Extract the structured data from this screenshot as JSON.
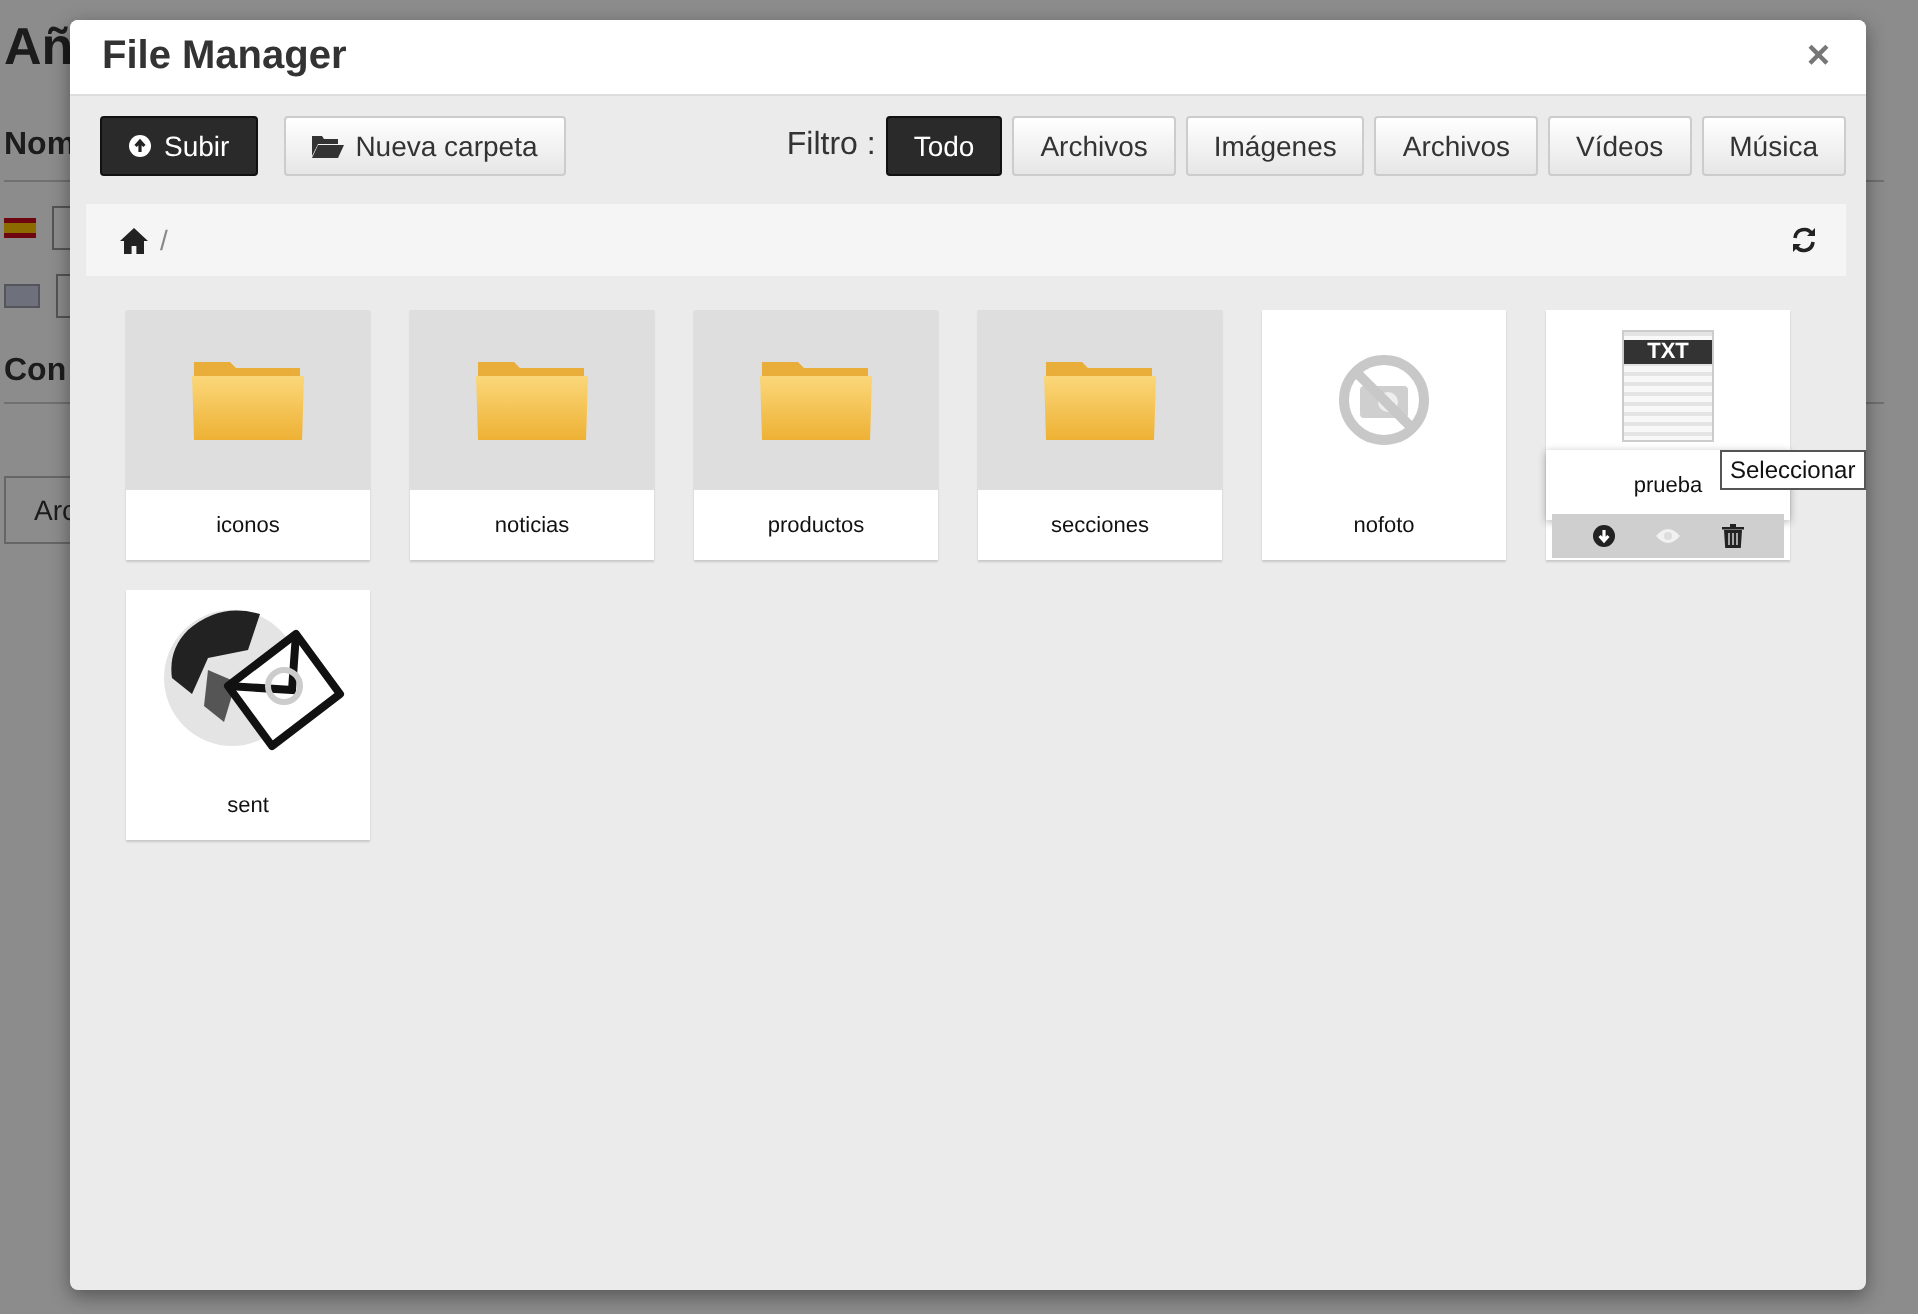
{
  "background_page": {
    "title": "Añ",
    "section_1": "Nom",
    "section_2": "Con",
    "tab": "Arc"
  },
  "modal": {
    "title": "File Manager",
    "close": "×"
  },
  "toolbar": {
    "upload": "Subir",
    "new_folder": "Nueva carpeta",
    "filter_label": "Filtro :",
    "filters": [
      {
        "label": "Todo",
        "selected": true
      },
      {
        "label": "Archivos",
        "selected": false
      },
      {
        "label": "Imágenes",
        "selected": false
      },
      {
        "label": "Archivos",
        "selected": false
      },
      {
        "label": "Vídeos",
        "selected": false
      },
      {
        "label": "Música",
        "selected": false
      }
    ]
  },
  "breadcrumb": {
    "separator": "/"
  },
  "items": [
    {
      "kind": "folder",
      "name": "iconos",
      "hovered": false
    },
    {
      "kind": "folder",
      "name": "noticias",
      "hovered": false
    },
    {
      "kind": "folder",
      "name": "productos",
      "hovered": false
    },
    {
      "kind": "folder",
      "name": "secciones",
      "hovered": false
    },
    {
      "kind": "nophoto",
      "name": "nofoto",
      "hovered": false
    },
    {
      "kind": "txt",
      "name": "prueba",
      "hovered": true,
      "badge": "TXT",
      "tooltip": "Seleccionar"
    },
    {
      "kind": "picture",
      "name": "sent",
      "hovered": false
    }
  ]
}
